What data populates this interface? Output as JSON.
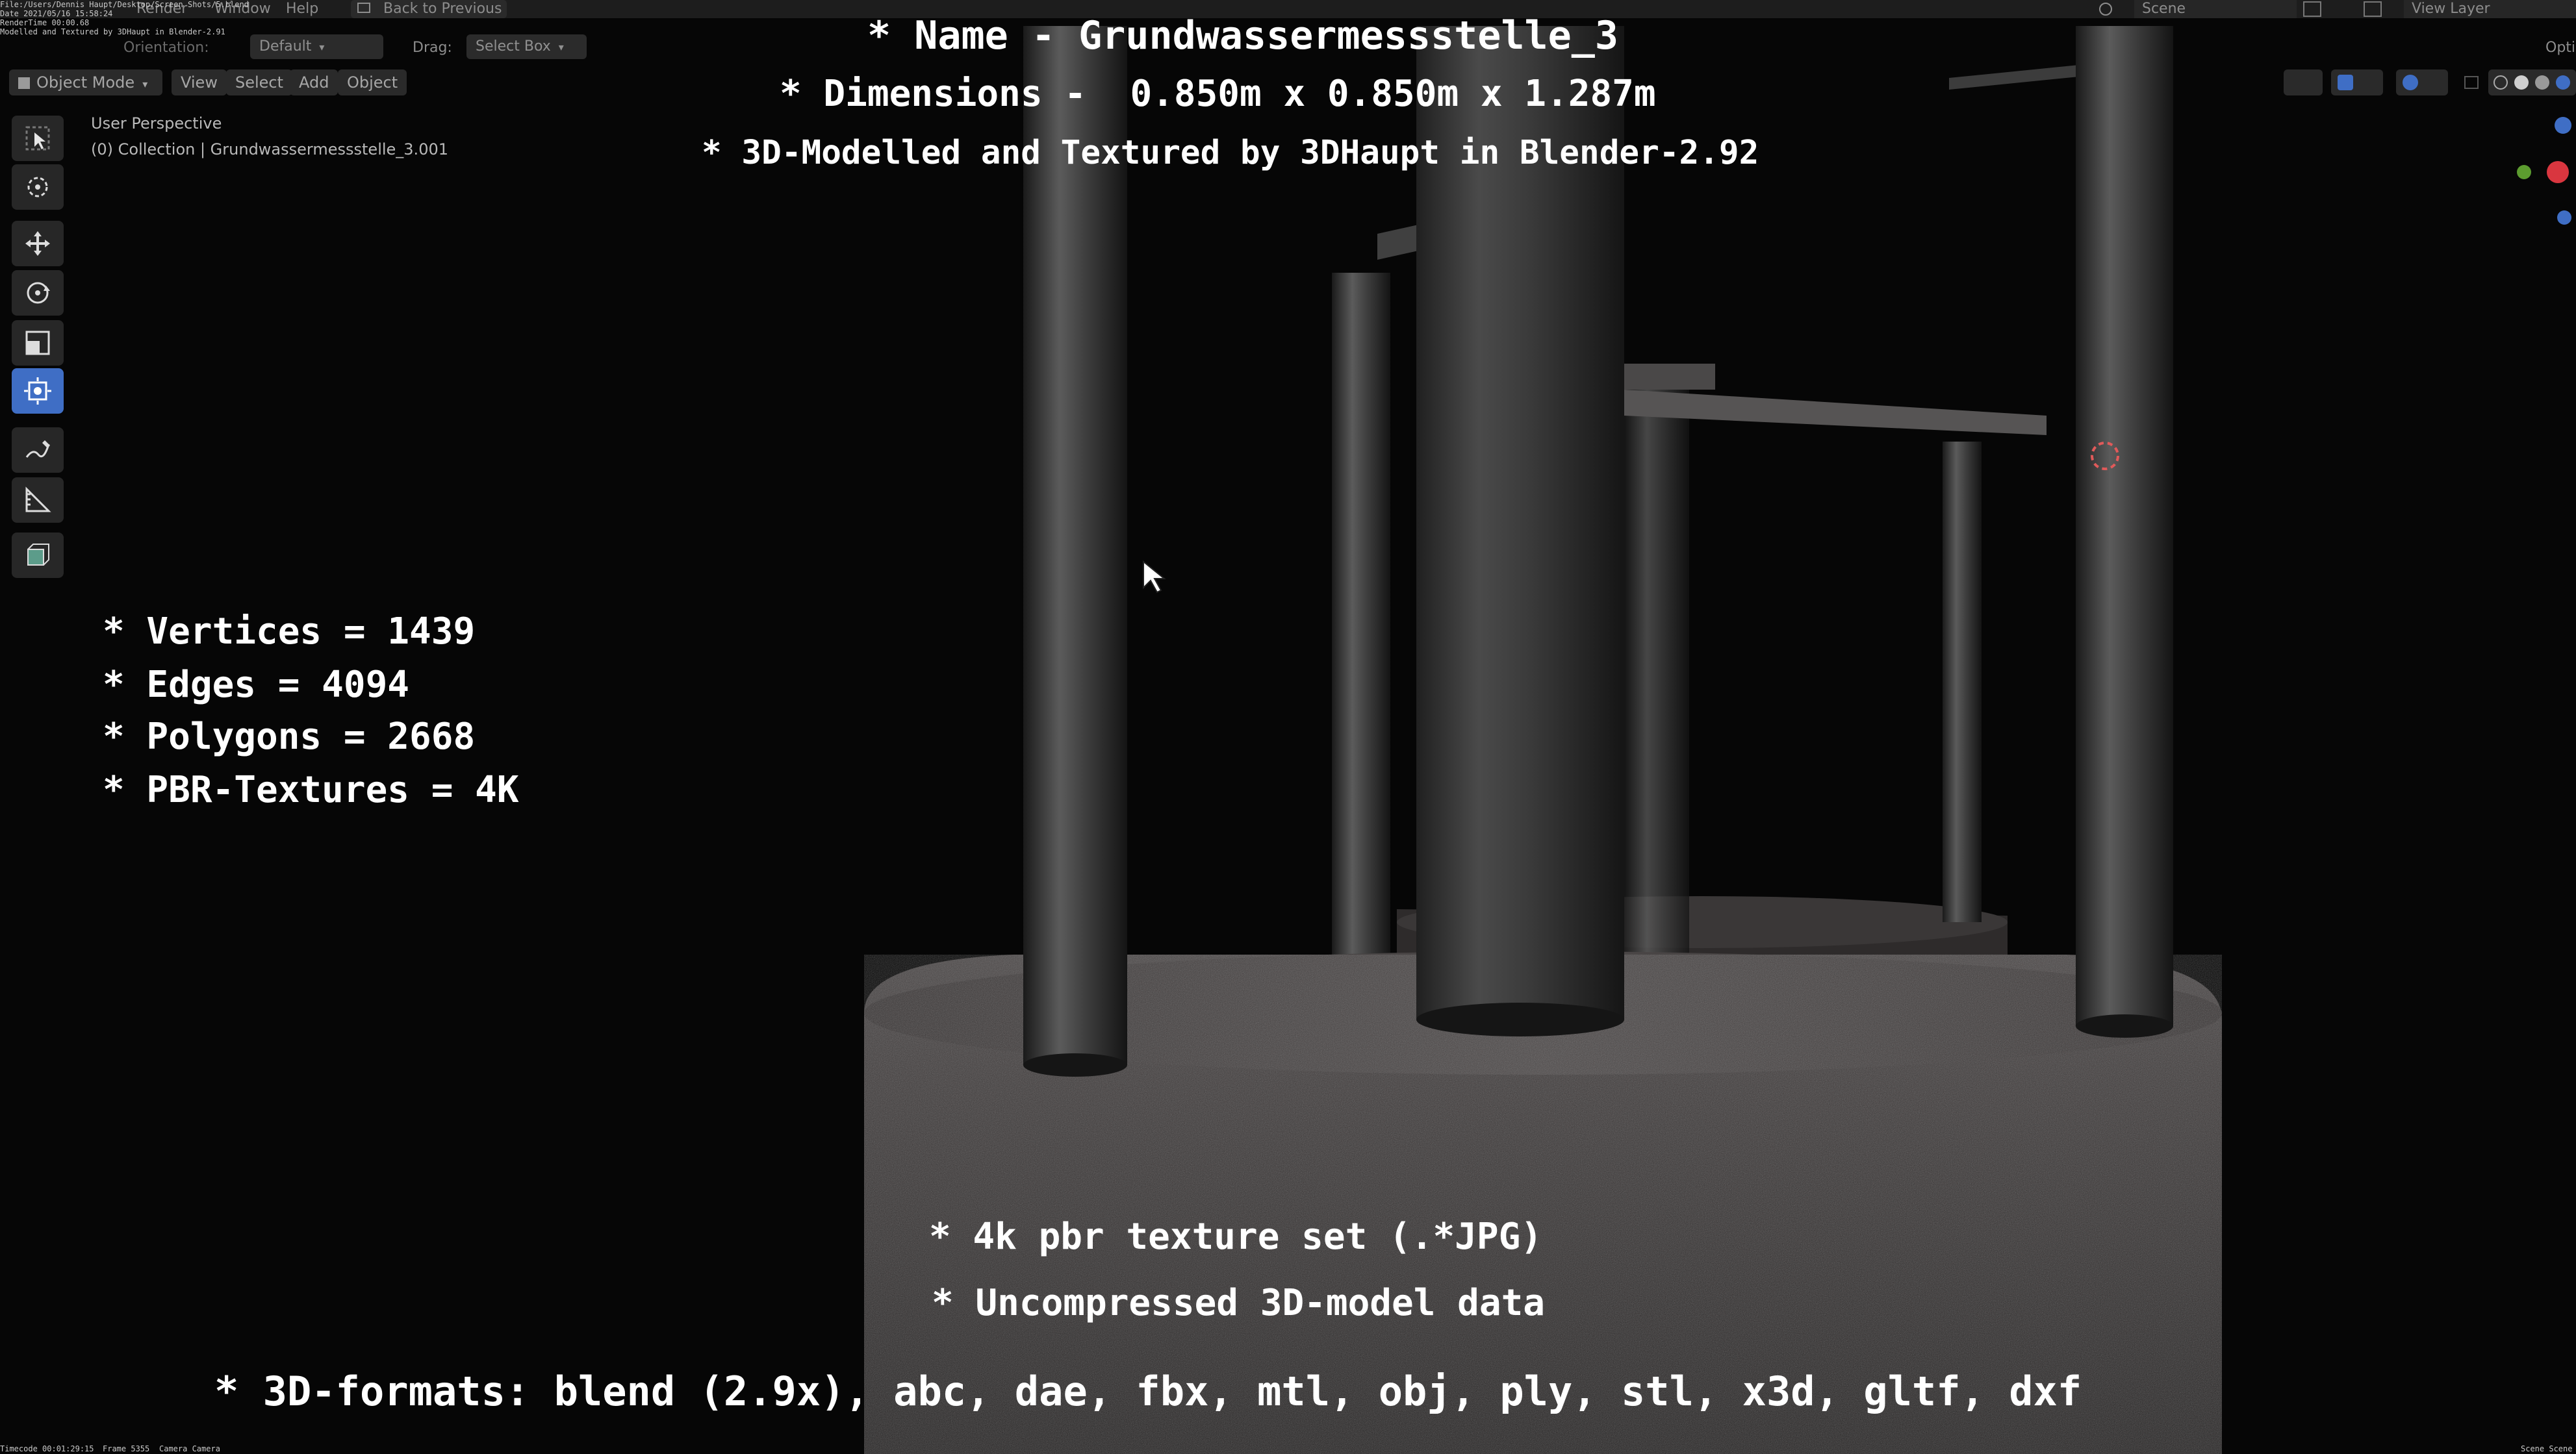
{
  "topbar": {
    "menu_render": "Render",
    "menu_window": "Window",
    "menu_help": "Help",
    "back_button": "Back to Previous",
    "scene_label": "Scene",
    "view_layer_label": "View Layer"
  },
  "render_stamp": {
    "file": "File:/Users/Dennis Haupt/Desktop/Screen Shots/5.blend",
    "date": "Date 2021/05/16 15:58:24",
    "render_time": "RenderTime 00:00.68",
    "note": "Modelled and Textured by 3DHaupt in Blender-2.91"
  },
  "toolbar": {
    "orientation_label": "Orientation:",
    "orientation_value": "Default",
    "drag_label": "Drag:",
    "drag_value": "Select Box",
    "options_label": "Opti"
  },
  "header": {
    "mode": "Object Mode",
    "view": "View",
    "select": "Select",
    "add": "Add",
    "object": "Object"
  },
  "viewport_info": {
    "perspective": "User Perspective",
    "collection": "(0) Collection | Grundwassermessstelle_3.001"
  },
  "overlay": {
    "name_line": "* Name - Grundwassermessstelle_3",
    "dimensions_line": "* Dimensions -  0.850m x 0.850m x 1.287m",
    "credit_line": "* 3D-Modelled and Textured by 3DHaupt in Blender-2.92",
    "stats": [
      "* Vertices = 1439",
      "* Edges = 4094",
      "* Polygons = 2668",
      "* PBR-Textures = 4K"
    ],
    "texture_line": "* 4k pbr texture set (.*JPG)",
    "data_line": "* Uncompressed 3D-model data",
    "formats_line": "* 3D-formats: blend (2.9x), abc, dae, fbx, mtl, obj, ply, stl, x3d, gltf, dxf"
  },
  "footer": {
    "timecode": "Timecode 00:01:29:15",
    "frame": "Frame 5355",
    "camera": "Camera Camera",
    "scene": "Scene Scene"
  },
  "icons": {
    "tools": [
      "select-box-icon",
      "cursor-icon",
      "move-icon",
      "rotate-icon",
      "scale-icon",
      "transform-icon",
      "annotate-icon",
      "measure-icon",
      "add-cube-icon"
    ]
  },
  "colors": {
    "active_tool": "#3f6ec5",
    "background": "#060606",
    "overlay_text": "#ffffff"
  }
}
